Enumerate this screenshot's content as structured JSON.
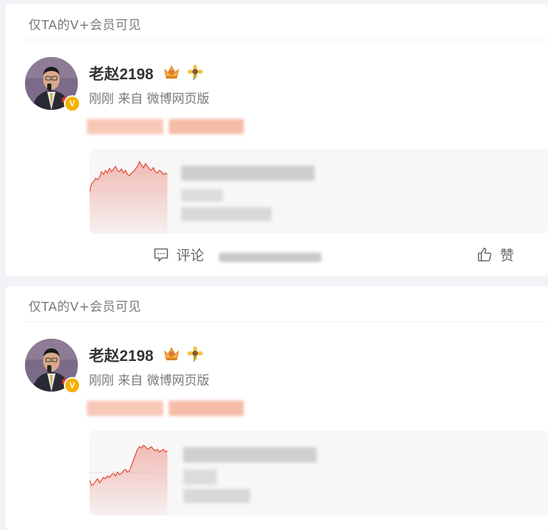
{
  "posts": [
    {
      "visibility": "仅TA的V+会员可见",
      "author": "老赵2198",
      "badge": "V",
      "meta": "刚刚 来自 微博网页版",
      "repost": {
        "chart_data": {
          "type": "line",
          "values": [
            40,
            52,
            55,
            60,
            58,
            62,
            70,
            66,
            72,
            68,
            75,
            70,
            74,
            78,
            72,
            70,
            74,
            68,
            72,
            66,
            64,
            68,
            70,
            74,
            78,
            85,
            80,
            76,
            82,
            78,
            74,
            72,
            76,
            70,
            68,
            72,
            70,
            66,
            68,
            66
          ],
          "color": "#e64a3b"
        }
      },
      "actions": {
        "comment": "评论",
        "like": "赞"
      }
    },
    {
      "visibility": "仅TA的V+会员可见",
      "author": "老赵2198",
      "badge": "V",
      "meta": "刚刚 来自 微博网页版",
      "repost": {
        "chart_data": {
          "type": "line",
          "values": [
            30,
            22,
            24,
            28,
            32,
            26,
            30,
            34,
            32,
            36,
            34,
            38,
            40,
            36,
            42,
            38,
            40,
            44,
            46,
            42,
            44,
            52,
            60,
            68,
            76,
            80,
            78,
            82,
            80,
            76,
            78,
            80,
            76,
            74,
            76,
            72,
            74,
            76,
            72,
            74
          ],
          "color": "#e64a3b"
        }
      },
      "actions": {
        "comment": "评论",
        "like": "赞"
      }
    }
  ]
}
